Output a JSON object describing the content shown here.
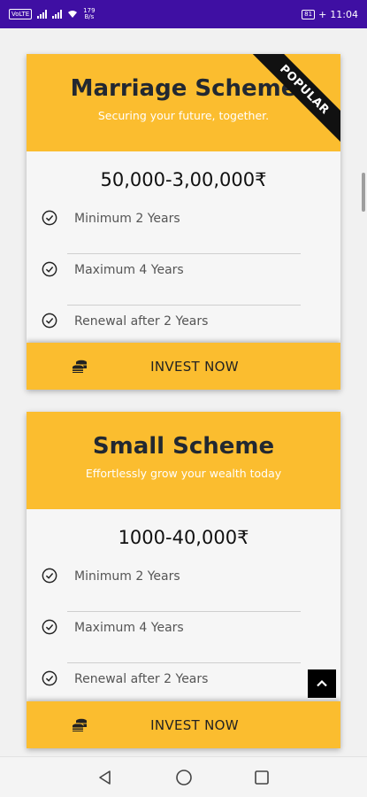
{
  "status_bar": {
    "volte": "VoLTE",
    "speed_value": "179",
    "speed_unit": "B/s",
    "battery": "81",
    "time": "11:04"
  },
  "cards": [
    {
      "title": "Marriage Scheme",
      "subtitle": "Securing your future, together.",
      "ribbon": "POPULAR",
      "price": "50,000-3,00,000₹",
      "features": [
        "Minimum 2 Years",
        "Maximum 4 Years",
        "Renewal after 2 Years"
      ],
      "cta": "INVEST NOW"
    },
    {
      "title": "Small Scheme",
      "subtitle": "Effortlessly grow your wealth today",
      "price": "1000-40,000₹",
      "features": [
        "Minimum 2 Years",
        "Maximum 4 Years",
        "Renewal after 2 Years"
      ],
      "cta": "INVEST NOW"
    }
  ],
  "colors": {
    "status_bar": "#3f0fa3",
    "accent": "#fbbd2f",
    "title_text": "#222831"
  },
  "icons": {
    "check": "check-circle-icon",
    "coins": "coins-icon",
    "back_to_top": "chevron-up-icon",
    "nav_back": "triangle-back-icon",
    "nav_home": "circle-home-icon",
    "nav_recent": "square-recent-icon"
  }
}
